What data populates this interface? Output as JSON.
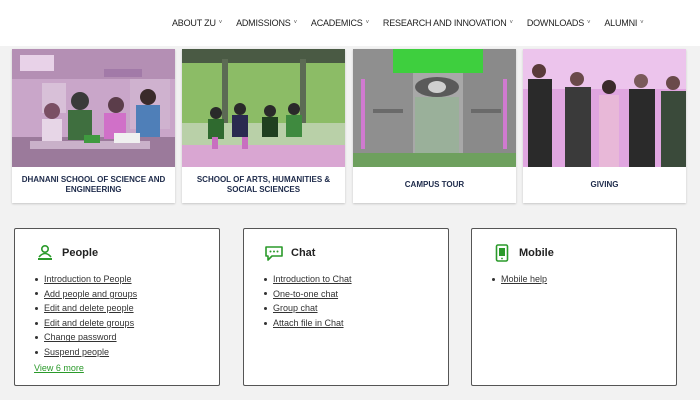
{
  "nav": {
    "items": [
      {
        "label": "ABOUT ZU",
        "caret": "˅"
      },
      {
        "label": "ADMISSIONS",
        "caret": "˅"
      },
      {
        "label": "ACADEMICS",
        "caret": "˅"
      },
      {
        "label": "RESEARCH AND INNOVATION",
        "caret": "˅"
      },
      {
        "label": "DOWNLOADS",
        "caret": "˅"
      },
      {
        "label": "ALUMNI",
        "caret": "˅"
      }
    ]
  },
  "cards": [
    {
      "caption": "DHANANI SCHOOL OF SCIENCE AND ENGINEERING"
    },
    {
      "caption": "SCHOOL OF ARTS, HUMANITIES & SOCIAL SCIENCES"
    },
    {
      "caption": "CAMPUS TOUR"
    },
    {
      "caption": "GIVING"
    }
  ],
  "boxes": {
    "people": {
      "title": "People",
      "links": [
        "Introduction to People",
        "Add people and groups",
        "Edit and delete people",
        "Edit and delete groups",
        "Change password",
        "Suspend people"
      ],
      "more": "View 6 more"
    },
    "chat": {
      "title": "Chat",
      "links": [
        "Introduction to Chat",
        "One-to-one chat",
        "Group chat",
        "Attach file in Chat"
      ]
    },
    "mobile": {
      "title": "Mobile",
      "links": [
        "Mobile help"
      ]
    }
  },
  "colors": {
    "accent_green": "#2a9a2a",
    "tint_magenta": "#d69ad6",
    "tint_green": "#9ad69a"
  }
}
